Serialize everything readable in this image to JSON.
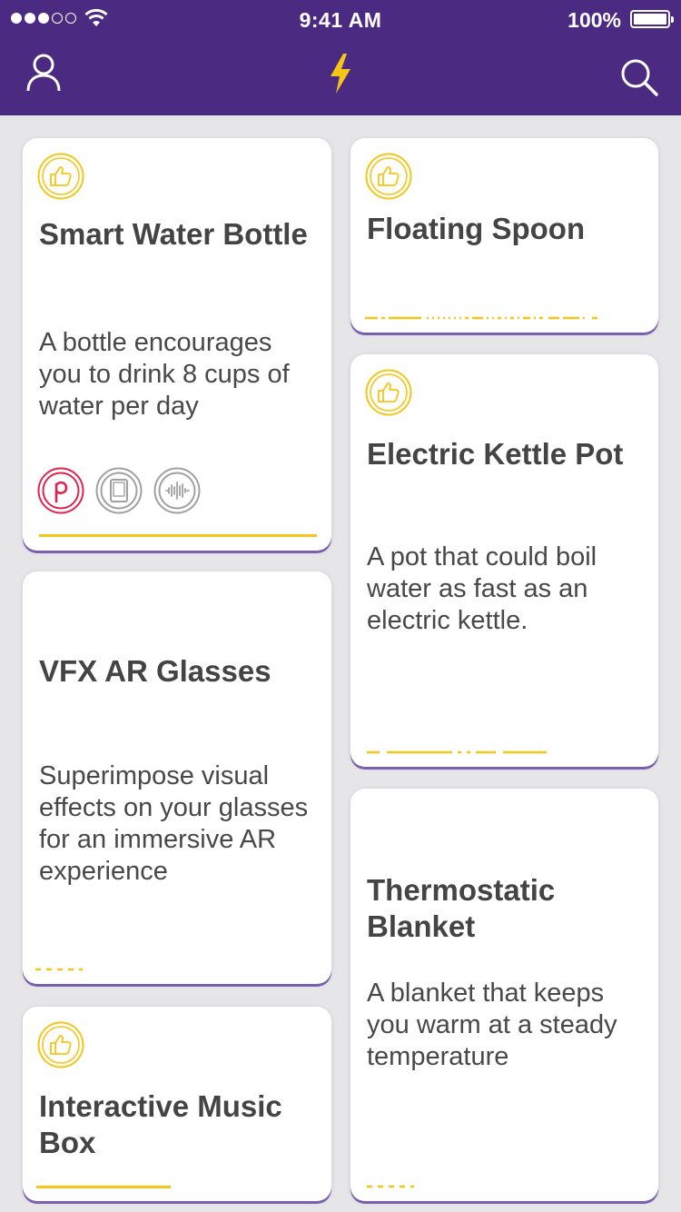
{
  "status_bar": {
    "time": "9:41 AM",
    "battery": "100%"
  },
  "nav": {
    "profile_icon": "person-icon",
    "logo_icon": "lightning-bolt-icon",
    "search_icon": "search-icon"
  },
  "colors": {
    "header": "#4b2b82",
    "accent": "#f5c518",
    "background": "#e6e6e9",
    "card_shadow": "#7a5fb0",
    "brand_p": "#e0234e"
  },
  "cards": {
    "smart_water_bottle": {
      "title": "Smart Water Bottle",
      "description": "A bottle encourages you to drink 8 cups of water per day",
      "liked": true,
      "apps": [
        "p-logo-icon",
        "tablet-icon",
        "soundwave-icon"
      ]
    },
    "floating_spoon": {
      "title": "Floating Spoon",
      "liked": true
    },
    "electric_kettle_pot": {
      "title": "Electric Kettle Pot",
      "description": "A pot that could boil water as fast as an electric kettle.",
      "liked": true
    },
    "vfx_ar_glasses": {
      "title": "VFX AR Glasses",
      "description": "Superimpose visual effects on your glasses for an immersive AR experience",
      "liked": false
    },
    "thermostatic_blanket": {
      "title": "Thermostatic Blanket",
      "description": "A blanket that keeps you warm at a steady temperature",
      "liked": false
    },
    "interactive_music_box": {
      "title": "Interactive Music Box",
      "liked": true
    }
  }
}
